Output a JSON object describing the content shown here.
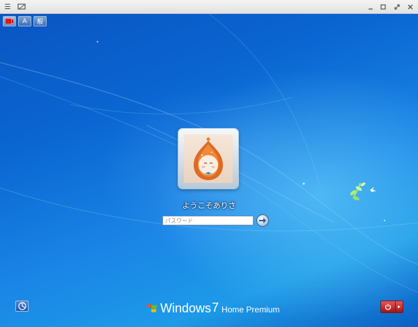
{
  "toolbar": {
    "icons": [
      "menu-icon",
      "display-icon",
      "minimize-icon",
      "restore-icon",
      "fullscreen-icon",
      "close-icon"
    ]
  },
  "language_bar": {
    "items": [
      "IME",
      "A",
      "般"
    ]
  },
  "user": {
    "name": "ようこそありさ",
    "avatar_icon": "candle-doll-avatar"
  },
  "password": {
    "placeholder": "パスワード",
    "value": ""
  },
  "branding": {
    "name": "Windows",
    "version": "7",
    "edition": "Home Premium"
  },
  "colors": {
    "desktop_blue": "#0a66d2",
    "power_red": "#c02020"
  }
}
